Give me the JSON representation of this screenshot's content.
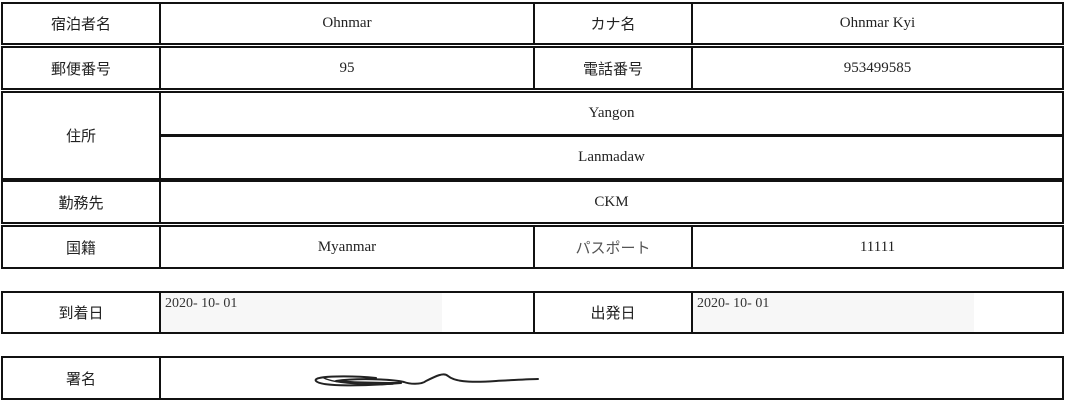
{
  "form": {
    "guest_name_label": "宿泊者名",
    "guest_name": "Ohnmar",
    "kana_label": "カナ名",
    "kana_name": "Ohnmar Kyi",
    "postal_label": "郵便番号",
    "postal_code": "95",
    "phone_label": "電話番号",
    "phone": "953499585",
    "address_label": "住所",
    "address_line1": "Yangon",
    "address_line2": "Lanmadaw",
    "workplace_label": "勤務先",
    "workplace": "CKM",
    "nationality_label": "国籍",
    "nationality": "Myanmar",
    "passport_label": "パスポート",
    "passport": "11111"
  },
  "dates": {
    "arrival_label": "到着日",
    "arrival_value": "2020- 10- 01",
    "departure_label": "出発日",
    "departure_value": "2020- 10- 01"
  },
  "signature": {
    "label": "署名"
  }
}
